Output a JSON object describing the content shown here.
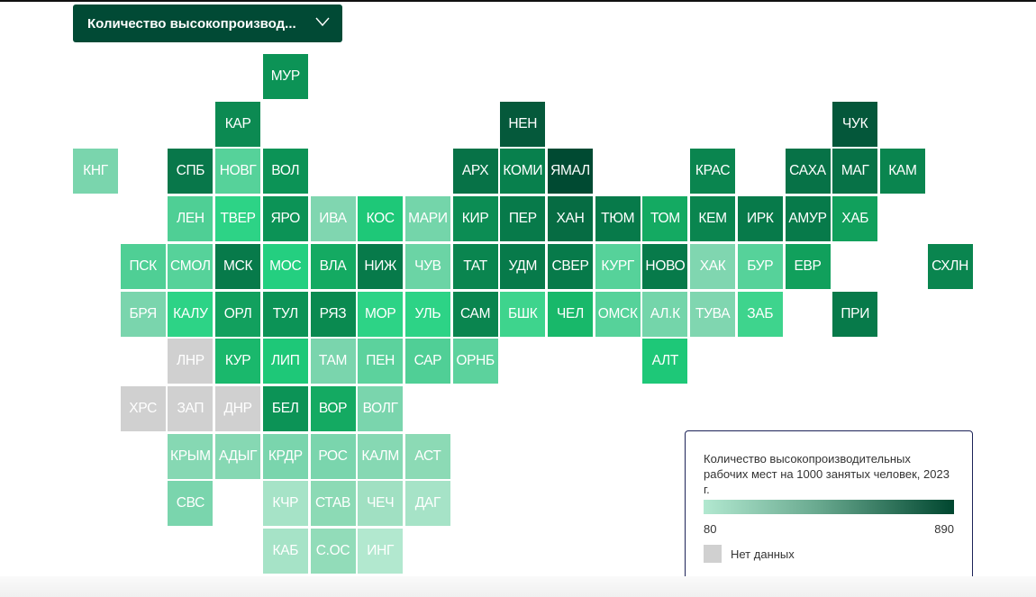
{
  "dropdown": {
    "label": "Количество высокопроизвод...",
    "icon": "chevron-down-icon"
  },
  "legend": {
    "title": "Количество высокопроизводительных рабочих мест на 1000 занятых человек, 2023 г.",
    "min": "80",
    "max": "890",
    "scale_colors": [
      "#b2e8d0",
      "#00462f"
    ],
    "no_data_label": "Нет данных",
    "no_data_color": "#d0d0d0"
  },
  "tiles": [
    {
      "label": "МУР",
      "row": 0,
      "col": 4,
      "color": "#0c9356"
    },
    {
      "label": "КАР",
      "row": 1,
      "col": 3,
      "color": "#0c8a52"
    },
    {
      "label": "НЕН",
      "row": 1,
      "col": 9,
      "color": "#05593b"
    },
    {
      "label": "ЧУК",
      "row": 1,
      "col": 16,
      "color": "#04573a"
    },
    {
      "label": "КНГ",
      "row": 2,
      "col": 0,
      "color": "#7ad5ad"
    },
    {
      "label": "СПБ",
      "row": 2,
      "col": 2,
      "color": "#08774a"
    },
    {
      "label": "НОВГ",
      "row": 2,
      "col": 3,
      "color": "#56d29a"
    },
    {
      "label": "ВОЛ",
      "row": 2,
      "col": 4,
      "color": "#0c9356"
    },
    {
      "label": "АРХ",
      "row": 2,
      "col": 8,
      "color": "#077247"
    },
    {
      "label": "КОМИ",
      "row": 2,
      "col": 9,
      "color": "#08804d"
    },
    {
      "label": "ЯМАЛ",
      "row": 2,
      "col": 10,
      "color": "#004a32"
    },
    {
      "label": "КРАС",
      "row": 2,
      "col": 13,
      "color": "#0a854f"
    },
    {
      "label": "САХА",
      "row": 2,
      "col": 15,
      "color": "#077247"
    },
    {
      "label": "МАГ",
      "row": 2,
      "col": 16,
      "color": "#077247"
    },
    {
      "label": "КАМ",
      "row": 2,
      "col": 17,
      "color": "#0a854f"
    },
    {
      "label": "ЛЕН",
      "row": 3,
      "col": 2,
      "color": "#4fcf95"
    },
    {
      "label": "ТВЕР",
      "row": 3,
      "col": 3,
      "color": "#2dd386"
    },
    {
      "label": "ЯРО",
      "row": 3,
      "col": 4,
      "color": "#0c9356"
    },
    {
      "label": "ИВА",
      "row": 3,
      "col": 5,
      "color": "#80d6b0"
    },
    {
      "label": "КОС",
      "row": 3,
      "col": 6,
      "color": "#1ec878"
    },
    {
      "label": "МАРИ",
      "row": 3,
      "col": 7,
      "color": "#74d5aa"
    },
    {
      "label": "КИР",
      "row": 3,
      "col": 8,
      "color": "#0c8d54"
    },
    {
      "label": "ПЕР",
      "row": 3,
      "col": 9,
      "color": "#077a4a"
    },
    {
      "label": "ХАН",
      "row": 3,
      "col": 10,
      "color": "#066c43"
    },
    {
      "label": "ТЮМ",
      "row": 3,
      "col": 11,
      "color": "#077a4a"
    },
    {
      "label": "ТОМ",
      "row": 3,
      "col": 12,
      "color": "#14aa62"
    },
    {
      "label": "КЕМ",
      "row": 3,
      "col": 13,
      "color": "#0a854f"
    },
    {
      "label": "ИРК",
      "row": 3,
      "col": 14,
      "color": "#077a4a"
    },
    {
      "label": "АМУР",
      "row": 3,
      "col": 15,
      "color": "#077a4a"
    },
    {
      "label": "ХАБ",
      "row": 3,
      "col": 16,
      "color": "#11a05c"
    },
    {
      "label": "ПСК",
      "row": 4,
      "col": 1,
      "color": "#4fcf95"
    },
    {
      "label": "СМОЛ",
      "row": 4,
      "col": 2,
      "color": "#56d29a"
    },
    {
      "label": "МСК",
      "row": 4,
      "col": 3,
      "color": "#077a4a"
    },
    {
      "label": "МОС",
      "row": 4,
      "col": 4,
      "color": "#24cf80"
    },
    {
      "label": "ВЛА",
      "row": 4,
      "col": 5,
      "color": "#14aa62"
    },
    {
      "label": "НИЖ",
      "row": 4,
      "col": 6,
      "color": "#077a4a"
    },
    {
      "label": "ЧУВ",
      "row": 4,
      "col": 7,
      "color": "#6bd4a5"
    },
    {
      "label": "ТАТ",
      "row": 4,
      "col": 8,
      "color": "#0a854f"
    },
    {
      "label": "УДМ",
      "row": 4,
      "col": 9,
      "color": "#077a4a"
    },
    {
      "label": "СВЕР",
      "row": 4,
      "col": 10,
      "color": "#077a4a"
    },
    {
      "label": "КУРГ",
      "row": 4,
      "col": 11,
      "color": "#56d29a"
    },
    {
      "label": "НОВО",
      "row": 4,
      "col": 12,
      "color": "#077a4a"
    },
    {
      "label": "ХАК",
      "row": 4,
      "col": 13,
      "color": "#80d6b0"
    },
    {
      "label": "БУР",
      "row": 4,
      "col": 14,
      "color": "#56d29a"
    },
    {
      "label": "ЕВР",
      "row": 4,
      "col": 15,
      "color": "#11a05c"
    },
    {
      "label": "СХЛН",
      "row": 4,
      "col": 18,
      "color": "#0a854f"
    },
    {
      "label": "БРЯ",
      "row": 5,
      "col": 1,
      "color": "#7ad5ad"
    },
    {
      "label": "КАЛУ",
      "row": 5,
      "col": 2,
      "color": "#2dd386"
    },
    {
      "label": "ОРЛ",
      "row": 5,
      "col": 3,
      "color": "#12a05e"
    },
    {
      "label": "ТУЛ",
      "row": 5,
      "col": 4,
      "color": "#0c9356"
    },
    {
      "label": "РЯЗ",
      "row": 5,
      "col": 5,
      "color": "#0a8a50"
    },
    {
      "label": "МОР",
      "row": 5,
      "col": 6,
      "color": "#2dd386"
    },
    {
      "label": "УЛЬ",
      "row": 5,
      "col": 7,
      "color": "#2dd386"
    },
    {
      "label": "САМ",
      "row": 5,
      "col": 8,
      "color": "#0a854f"
    },
    {
      "label": "БШК",
      "row": 5,
      "col": 9,
      "color": "#3ed48d"
    },
    {
      "label": "ЧЕЛ",
      "row": 5,
      "col": 10,
      "color": "#18b86a"
    },
    {
      "label": "ОМСК",
      "row": 5,
      "col": 11,
      "color": "#56d29a"
    },
    {
      "label": "АЛ.К",
      "row": 5,
      "col": 12,
      "color": "#74d5aa"
    },
    {
      "label": "ТУВА",
      "row": 5,
      "col": 13,
      "color": "#80d6b0"
    },
    {
      "label": "ЗАБ",
      "row": 5,
      "col": 14,
      "color": "#3ed48d"
    },
    {
      "label": "ПРИ",
      "row": 5,
      "col": 16,
      "color": "#077a4a"
    },
    {
      "label": "ЛНР",
      "row": 6,
      "col": 2,
      "color": "#d0d0d0"
    },
    {
      "label": "КУР",
      "row": 6,
      "col": 3,
      "color": "#1ab86c"
    },
    {
      "label": "ЛИП",
      "row": 6,
      "col": 4,
      "color": "#1ec878"
    },
    {
      "label": "ТАМ",
      "row": 6,
      "col": 5,
      "color": "#7ad5ad"
    },
    {
      "label": "ПЕН",
      "row": 6,
      "col": 6,
      "color": "#5cd29d"
    },
    {
      "label": "САР",
      "row": 6,
      "col": 7,
      "color": "#50cf96"
    },
    {
      "label": "ОРНБ",
      "row": 6,
      "col": 8,
      "color": "#5cd29d"
    },
    {
      "label": "АЛТ",
      "row": 6,
      "col": 12,
      "color": "#1ec878"
    },
    {
      "label": "ХРС",
      "row": 7,
      "col": 1,
      "color": "#d0d0d0"
    },
    {
      "label": "ЗАП",
      "row": 7,
      "col": 2,
      "color": "#d0d0d0"
    },
    {
      "label": "ДНР",
      "row": 7,
      "col": 3,
      "color": "#d0d0d0"
    },
    {
      "label": "БЕЛ",
      "row": 7,
      "col": 4,
      "color": "#0c9356"
    },
    {
      "label": "ВОР",
      "row": 7,
      "col": 5,
      "color": "#14aa62"
    },
    {
      "label": "ВОЛГ",
      "row": 7,
      "col": 6,
      "color": "#7ad5ad"
    },
    {
      "label": "КРЫМ",
      "row": 8,
      "col": 2,
      "color": "#86d8b3"
    },
    {
      "label": "АДЫГ",
      "row": 8,
      "col": 3,
      "color": "#86d8b3"
    },
    {
      "label": "КРДР",
      "row": 8,
      "col": 4,
      "color": "#7ad5ad"
    },
    {
      "label": "РОС",
      "row": 8,
      "col": 5,
      "color": "#7ad5ad"
    },
    {
      "label": "КАЛМ",
      "row": 8,
      "col": 6,
      "color": "#86d8b3"
    },
    {
      "label": "АСТ",
      "row": 8,
      "col": 7,
      "color": "#8cdab5"
    },
    {
      "label": "СВС",
      "row": 9,
      "col": 2,
      "color": "#7ad5ad"
    },
    {
      "label": "КЧР",
      "row": 9,
      "col": 4,
      "color": "#a6e3c7"
    },
    {
      "label": "СТАВ",
      "row": 9,
      "col": 5,
      "color": "#8cdab5"
    },
    {
      "label": "ЧЕЧ",
      "row": 9,
      "col": 6,
      "color": "#a0e0c2"
    },
    {
      "label": "ДАГ",
      "row": 9,
      "col": 7,
      "color": "#a6e3c7"
    },
    {
      "label": "КАБ",
      "row": 10,
      "col": 4,
      "color": "#a6e3c7"
    },
    {
      "label": "С.ОС",
      "row": 10,
      "col": 5,
      "color": "#92dcb9"
    },
    {
      "label": "ИНГ",
      "row": 10,
      "col": 6,
      "color": "#b2e8cf"
    }
  ]
}
